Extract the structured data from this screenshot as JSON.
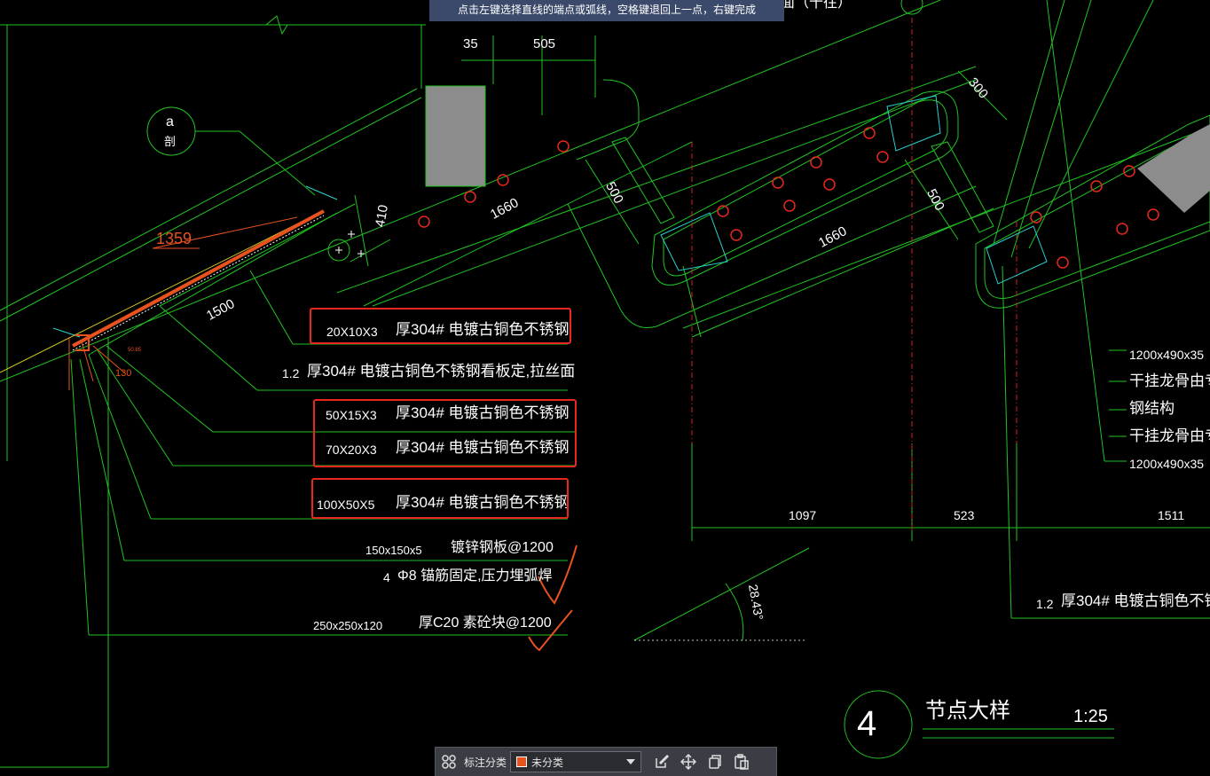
{
  "command_prompt": "点击左键选择直线的端点或弧线，空格键退回上一点，右键完成",
  "colors": {
    "background": "#000000",
    "line_green": "#21c421",
    "dim_text": "#ffffff",
    "highlight_red": "#e8281e",
    "orange": "#e8521e",
    "red_axis": "#d42020",
    "yellow": "#d8d020",
    "cyan": "#2ad0d0"
  },
  "drawing": {
    "partial_title": "面（十往）",
    "dims_top": [
      "35",
      "505"
    ],
    "dim_300": "300",
    "dim_410": "410",
    "dim_1660_a": "1660",
    "dim_500_a": "500",
    "dim_1660_b": "1660",
    "dim_500_b": "500",
    "dim_1500": "1500",
    "dim_1359": "1359",
    "bottom_dims": [
      "1097",
      "523",
      "1511"
    ],
    "angle": "28.43°",
    "detail_mark": "a",
    "detail_sub": "剖",
    "small_labels": [
      "50.85",
      "130"
    ]
  },
  "annotations_left": [
    {
      "spec": "20X10X3",
      "text": "厚304# 电镀古铜色不锈钢"
    },
    {
      "spec": "1.2",
      "text": "厚304# 电镀古铜色不锈钢看板定,拉丝面"
    },
    {
      "spec": "50X15X3",
      "text": "厚304# 电镀古铜色不锈钢"
    },
    {
      "spec": "70X20X3",
      "text": "厚304# 电镀古铜色不锈钢"
    },
    {
      "spec": "100X50X5",
      "text": "厚304# 电镀古铜色不锈钢"
    },
    {
      "spec": "150x150x5",
      "text": "镀锌钢板@1200"
    },
    {
      "spec": "4",
      "text": "Φ8 锚筋固定,压力埋弧焊"
    },
    {
      "spec": "250x250x120",
      "text": "厚C20  素砼块@1200"
    }
  ],
  "annotations_right": [
    "1200x490x35",
    "干挂龙骨由专",
    "钢结构",
    "干挂龙骨由专",
    "1200x490x35"
  ],
  "annotation_right_bottom": {
    "spec": "1.2",
    "text": "厚304# 电镀古铜色不锈"
  },
  "title_block": {
    "number": "4",
    "title": "节点大样",
    "scale": "1:25"
  },
  "toolbar": {
    "grid_icon": "grid-icon",
    "label": "标注分类",
    "select_value": "未分类",
    "icons": [
      "edit-icon",
      "move-icon",
      "copy-icon",
      "paste-icon"
    ]
  }
}
